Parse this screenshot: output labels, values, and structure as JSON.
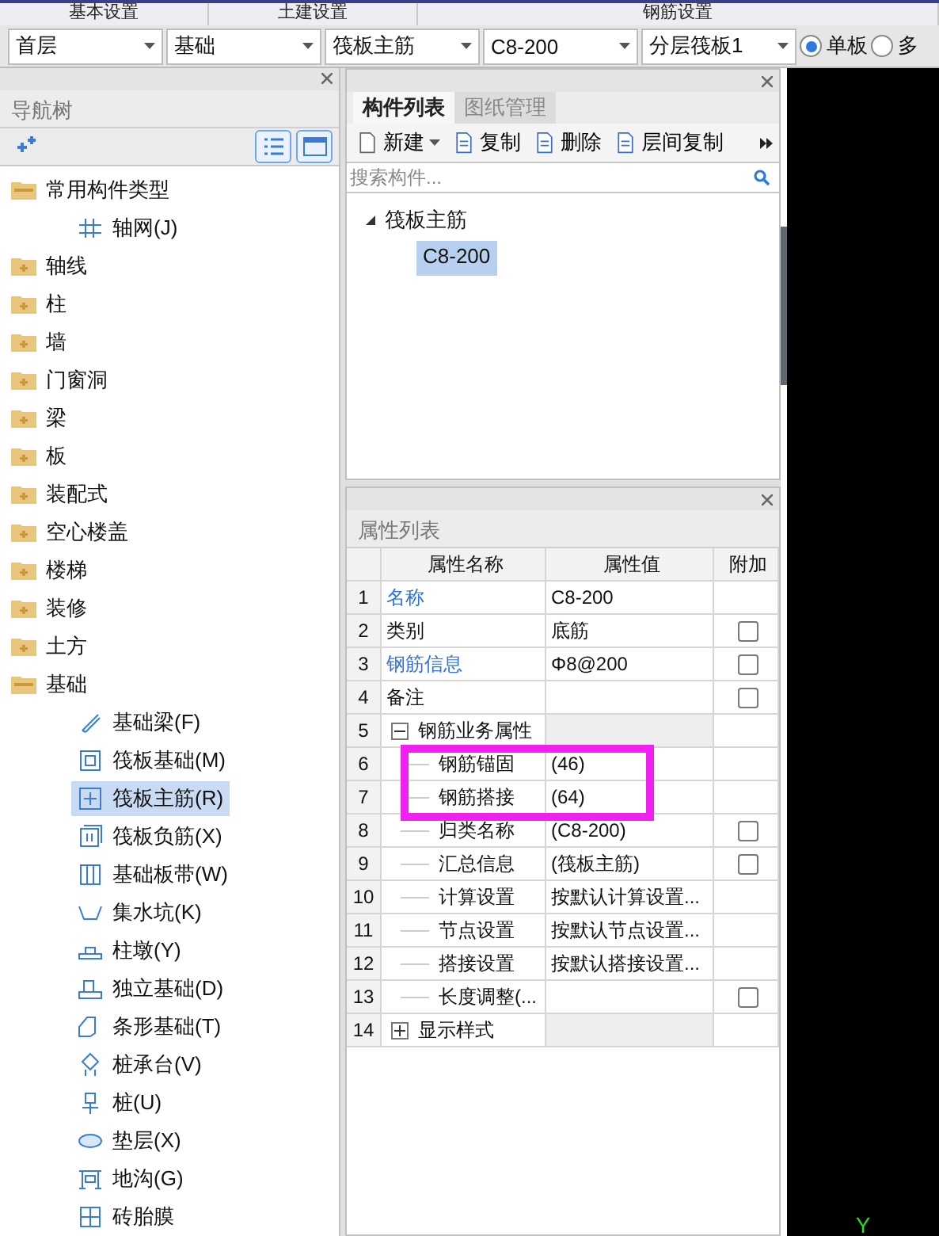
{
  "menu_tabs": [
    {
      "label": "基本设置"
    },
    {
      "label": "土建设置"
    },
    {
      "label": "钢筋设置"
    }
  ],
  "selectors": [
    {
      "value": "首层"
    },
    {
      "value": "基础"
    },
    {
      "value": "筏板主筋"
    },
    {
      "value": "C8-200"
    },
    {
      "value": "分层筏板1"
    }
  ],
  "board_mode": [
    {
      "label": "单板",
      "selected": true
    },
    {
      "label": "多",
      "selected": false
    }
  ],
  "nav_panel": {
    "title": "导航树",
    "tree": [
      {
        "label": "常用构件类型",
        "expanded": true,
        "children": [
          {
            "label": "轴网(J)",
            "selected": false
          }
        ]
      },
      {
        "label": "轴线",
        "expanded": false
      },
      {
        "label": "柱",
        "expanded": false
      },
      {
        "label": "墙",
        "expanded": false
      },
      {
        "label": "门窗洞",
        "expanded": false
      },
      {
        "label": "梁",
        "expanded": false
      },
      {
        "label": "板",
        "expanded": false
      },
      {
        "label": "装配式",
        "expanded": false
      },
      {
        "label": "空心楼盖",
        "expanded": false
      },
      {
        "label": "楼梯",
        "expanded": false
      },
      {
        "label": "装修",
        "expanded": false
      },
      {
        "label": "土方",
        "expanded": false
      },
      {
        "label": "基础",
        "expanded": true,
        "children": [
          {
            "label": "基础梁(F)",
            "selected": false
          },
          {
            "label": "筏板基础(M)",
            "selected": false
          },
          {
            "label": "筏板主筋(R)",
            "selected": true
          },
          {
            "label": "筏板负筋(X)",
            "selected": false
          },
          {
            "label": "基础板带(W)",
            "selected": false
          },
          {
            "label": "集水坑(K)",
            "selected": false
          },
          {
            "label": "柱墩(Y)",
            "selected": false
          },
          {
            "label": "独立基础(D)",
            "selected": false
          },
          {
            "label": "条形基础(T)",
            "selected": false
          },
          {
            "label": "桩承台(V)",
            "selected": false
          },
          {
            "label": "桩(U)",
            "selected": false
          },
          {
            "label": "垫层(X)",
            "selected": false
          },
          {
            "label": "地沟(G)",
            "selected": false
          },
          {
            "label": "砖胎膜",
            "selected": false
          }
        ]
      }
    ]
  },
  "component_panel": {
    "tabs": [
      {
        "label": "构件列表",
        "selected": true
      },
      {
        "label": "图纸管理",
        "selected": false
      }
    ],
    "toolbar": [
      {
        "label": "新建",
        "kind": "dropdown"
      },
      {
        "label": "复制",
        "kind": "button"
      },
      {
        "label": "删除",
        "kind": "button"
      },
      {
        "label": "层间复制",
        "kind": "button"
      }
    ],
    "search": {
      "placeholder": "搜索构件..."
    },
    "tree": [
      {
        "label": "筏板主筋",
        "expanded": true,
        "children": [
          {
            "label": "C8-200",
            "selected": true
          }
        ]
      }
    ]
  },
  "property_panel": {
    "title": "属性列表",
    "columns": [
      "属性名称",
      "属性值",
      "附加"
    ],
    "rows": [
      {
        "num": "1",
        "name": "名称",
        "value": "C8-200",
        "kind": "link"
      },
      {
        "num": "2",
        "name": "类别",
        "value": "底筋",
        "kind": "plain",
        "checked": false
      },
      {
        "num": "3",
        "name": "钢筋信息",
        "value": "Φ8@200",
        "kind": "link",
        "checked": false
      },
      {
        "num": "4",
        "name": "备注",
        "kind": "plain",
        "checked": false
      },
      {
        "num": "5",
        "name": "钢筋业务属性",
        "kind": "group",
        "expanded": true,
        "children": [
          {
            "num": "6",
            "name": "钢筋锚固",
            "value": "(46)"
          },
          {
            "num": "7",
            "name": "钢筋搭接",
            "value": "(64)"
          },
          {
            "num": "8",
            "name": "归类名称",
            "value": "(C8-200)",
            "checked": false
          },
          {
            "num": "9",
            "name": "汇总信息",
            "value": "(筏板主筋)",
            "checked": false
          },
          {
            "num": "10",
            "name": "计算设置",
            "value": "按默认计算设置..."
          },
          {
            "num": "11",
            "name": "节点设置",
            "value": "按默认节点设置..."
          },
          {
            "num": "12",
            "name": "搭接设置",
            "value": "按默认搭接设置..."
          },
          {
            "num": "13",
            "name": "长度调整(...",
            "checked": false
          }
        ]
      },
      {
        "num": "14",
        "name": "显示样式",
        "kind": "group",
        "expanded": false
      }
    ]
  },
  "canvas": {
    "axis_label": "Y"
  }
}
